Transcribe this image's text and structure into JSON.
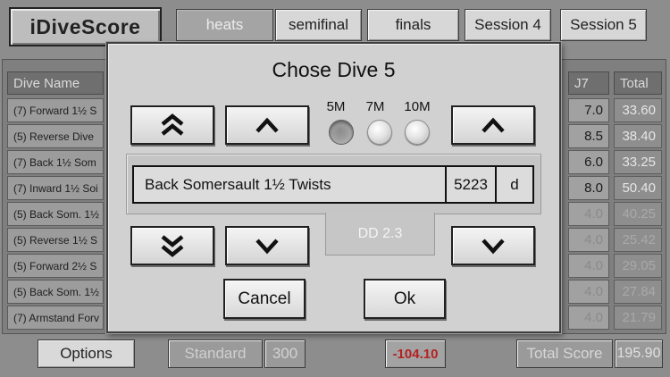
{
  "header": {
    "app_title": "iDiveScore",
    "tabs": [
      {
        "label": "heats",
        "active": true
      },
      {
        "label": "semifinal",
        "active": false
      },
      {
        "label": "finals",
        "active": false
      },
      {
        "label": "Session 4",
        "active": false
      },
      {
        "label": "Session 5",
        "active": false
      }
    ]
  },
  "table": {
    "columns": {
      "dive_name": "Dive Name",
      "j7": "J7",
      "total": "Total"
    },
    "rows": [
      {
        "dive": "(7) Forward 1½ S",
        "j7": "7.0",
        "total": "33.60",
        "active": true
      },
      {
        "dive": "(5) Reverse Dive",
        "j7": "8.5",
        "total": "38.40",
        "active": true
      },
      {
        "dive": "(7) Back 1½ Som",
        "j7": "6.0",
        "total": "33.25",
        "active": true
      },
      {
        "dive": "(7) Inward 1½ Soi",
        "j7": "8.0",
        "total": "50.40",
        "active": true
      },
      {
        "dive": "(5) Back Som. 1½",
        "j7": "4.0",
        "total": "40.25",
        "active": false
      },
      {
        "dive": "(5) Reverse 1½ S",
        "j7": "4.0",
        "total": "25.42",
        "active": false
      },
      {
        "dive": "(5) Forward 2½ S",
        "j7": "4.0",
        "total": "29.05",
        "active": false
      },
      {
        "dive": "(5) Back Som. 1½",
        "j7": "4.0",
        "total": "27.84",
        "active": false
      },
      {
        "dive": "(7) Armstand Forv",
        "j7": "4.0",
        "total": "21.79",
        "active": false
      }
    ]
  },
  "footer": {
    "options_label": "Options",
    "standard_label": "Standard",
    "standard_value": "300",
    "difference": "-104.10",
    "total_score_label": "Total Score",
    "total_score_value": "195.90"
  },
  "dialog": {
    "title": "Chose Dive 5",
    "boards": [
      {
        "label": "5M",
        "selected": true
      },
      {
        "label": "7M",
        "selected": false
      },
      {
        "label": "10M",
        "selected": false
      }
    ],
    "dive_name": "Back Somersault 1½ Twists",
    "dive_number": "5223",
    "dive_position": "d",
    "dd": "DD 2.3",
    "cancel_label": "Cancel",
    "ok_label": "Ok"
  },
  "icons": {
    "double_up": "double-chevron-up-icon",
    "up": "chevron-up-icon",
    "double_down": "double-chevron-down-icon",
    "down": "chevron-down-icon"
  },
  "colors": {
    "difference_text": "#b52121",
    "dd_text": "#f4f4f4"
  }
}
